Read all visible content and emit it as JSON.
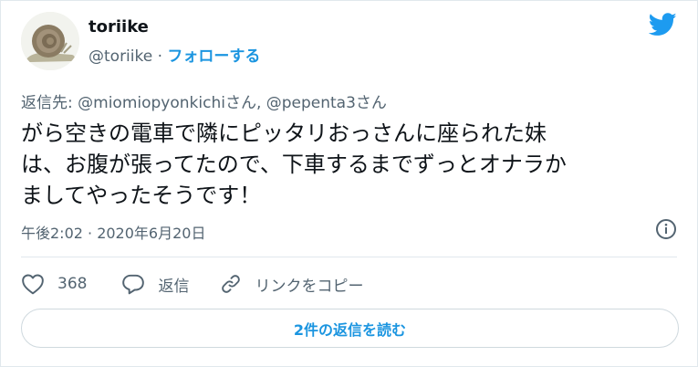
{
  "tweet": {
    "author": {
      "display_name": "toriike",
      "handle": "@toriike",
      "avatar_icon": "snail-avatar"
    },
    "separator": "·",
    "follow_label": "フォローする",
    "brand_icon": "twitter-bird-icon",
    "reply_to": "返信先: @miomiopyonkichiさん, @pepenta3さん",
    "text": "がら空きの電車で隣にピッタリおっさんに座られた妹\nは、お腹が張ってたので、下車するまでずっとオナラか\nましてやったそうです！",
    "timestamp": "午後2:02 · 2020年6月20日",
    "info_icon": "info-icon"
  },
  "actions": {
    "like_count": "368",
    "reply_label": "返信",
    "copy_link_label": "リンクをコピー"
  },
  "read_replies_label": "2件の返信を読む",
  "colors": {
    "accent": "#1b95e0",
    "secondary_text": "#536471",
    "primary_text": "#0f1419",
    "border": "#e1e8ed"
  }
}
